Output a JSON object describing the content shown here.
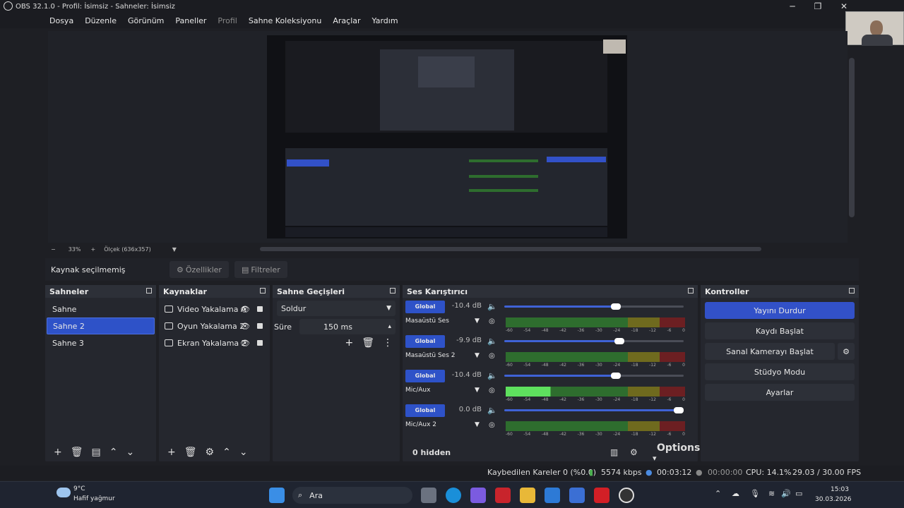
{
  "window": {
    "title": "OBS 32.1.0 - Profil: İsimsiz - Sahneler: İsimsiz",
    "minimize": "─",
    "maximize": "❐",
    "close": "✕"
  },
  "menu": {
    "items": [
      "Dosya",
      "Düzenle",
      "Görünüm",
      "Paneller",
      "Profil",
      "Sahne Koleksiyonu",
      "Araçlar",
      "Yardım"
    ]
  },
  "zoom": {
    "level": "33%",
    "scale_label": "Ölçek (636x357)"
  },
  "context": {
    "no_source": "Kaynak seçilmemiş",
    "properties": "Özellikler",
    "filters": "Filtreler"
  },
  "scenes": {
    "title": "Sahneler",
    "items": [
      "Sahne",
      "Sahne 2",
      "Sahne 3"
    ],
    "selected_index": 1
  },
  "sources": {
    "title": "Kaynaklar",
    "items": [
      {
        "name": "Video Yakalama A",
        "icon": "camera-icon"
      },
      {
        "name": "Oyun Yakalama 2",
        "icon": "gamepad-icon"
      },
      {
        "name": "Ekran Yakalama 2",
        "icon": "monitor-icon"
      }
    ]
  },
  "transitions": {
    "title": "Sahne Geçişleri",
    "selected": "Soldur",
    "duration_label": "Süre",
    "duration_value": "150 ms"
  },
  "mixer": {
    "title": "Ses Karıştırıcı",
    "global_label": "Global",
    "channels": [
      {
        "name": "Masaüstü Ses",
        "db": "-10.4 dB",
        "volume": 0.63,
        "level": 0.0
      },
      {
        "name": "Masaüstü Ses 2",
        "db": "-9.9 dB",
        "volume": 0.65,
        "level": 0.0
      },
      {
        "name": "Mic/Aux",
        "db": "-10.4 dB",
        "volume": 0.63,
        "level": 0.25
      },
      {
        "name": "Mic/Aux 2",
        "db": "0.0 dB",
        "volume": 1.0,
        "level": 0.0
      }
    ],
    "ticks": [
      "-60",
      "-54",
      "-48",
      "-42",
      "-36",
      "-30",
      "-24",
      "-18",
      "-12",
      "-6",
      "0"
    ],
    "hidden": "0 hidden",
    "options": "Options"
  },
  "controls": {
    "title": "Kontroller",
    "stop_stream": "Yayını Durdur",
    "start_record": "Kaydı Başlat",
    "start_vcam": "Sanal Kamerayı Başlat",
    "studio_mode": "Stüdyo Modu",
    "settings": "Ayarlar"
  },
  "status": {
    "dropped": "Kaybedilen Kareler 0 (%0.0)",
    "bitrate": "5574 kbps",
    "stream_time": "00:03:12",
    "rec_time": "00:00:00",
    "cpu": "CPU: 14.1%",
    "fps": "29.03 / 30.00 FPS"
  },
  "taskbar": {
    "temp": "9°C",
    "weather": "Hafif yağmur",
    "search": "Ara",
    "time": "15:03",
    "date": "30.03.2026"
  }
}
